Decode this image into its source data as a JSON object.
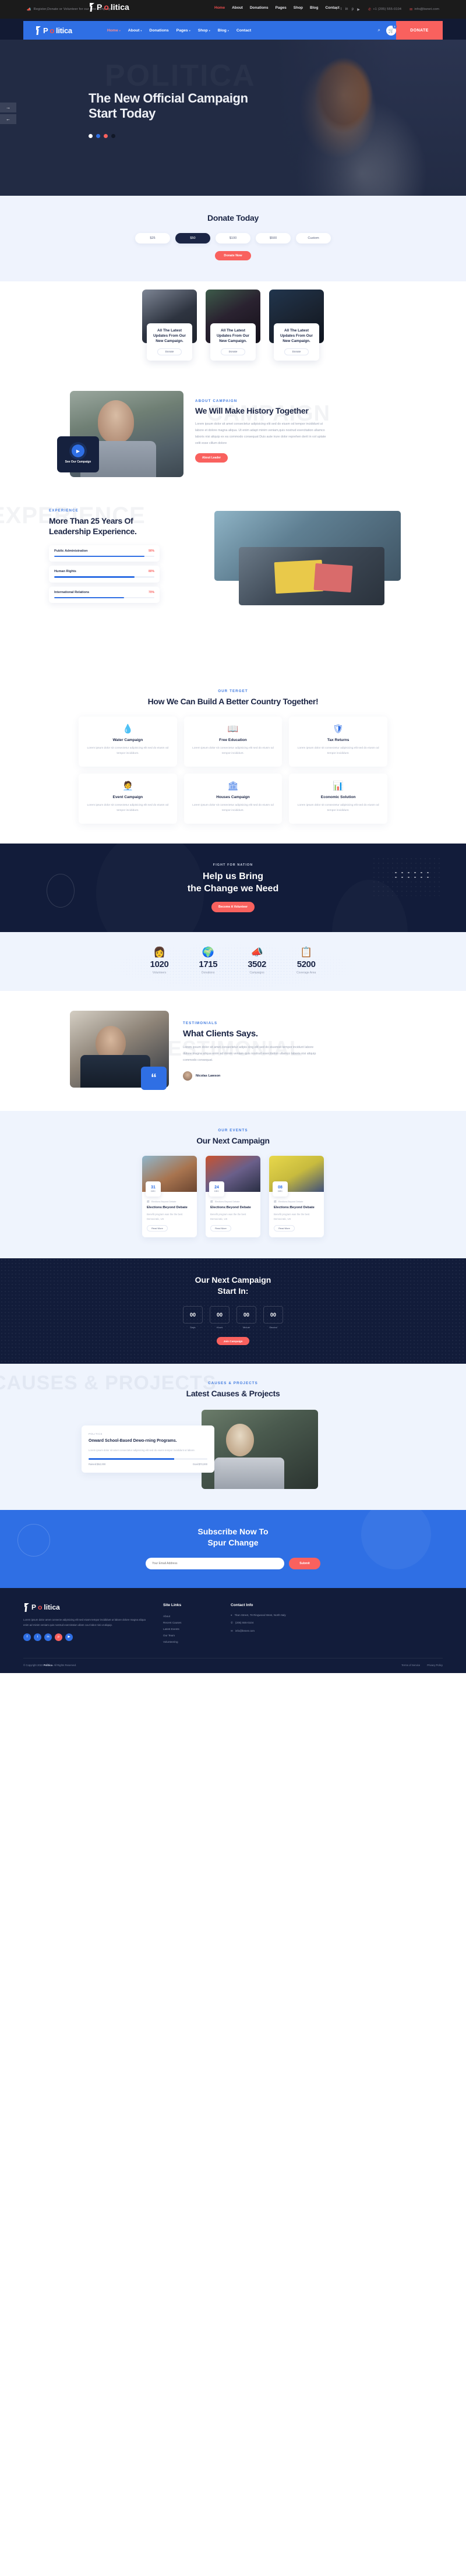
{
  "brand": {
    "name_pre": "P",
    "name_o": "o",
    "name_post": "litica",
    "full": "Politica"
  },
  "topbar": {
    "announce": "Register,Donate or Volunteer for our new campaign",
    "phone": "+1 (205) 555-0104",
    "email": "info@bsnet.com",
    "socials": [
      "f",
      "t",
      "in",
      "p",
      "yt"
    ]
  },
  "nav": {
    "items": [
      {
        "label": "Home",
        "caret": true,
        "active": true
      },
      {
        "label": "About",
        "caret": true,
        "active": false
      },
      {
        "label": "Donations",
        "caret": false,
        "active": false
      },
      {
        "label": "Pages",
        "caret": true,
        "active": false
      },
      {
        "label": "Shop",
        "caret": true,
        "active": false
      },
      {
        "label": "Blog",
        "caret": true,
        "active": false
      },
      {
        "label": "Contact",
        "caret": false,
        "active": false
      }
    ],
    "search_icon": "search-icon",
    "cart_icon": "cart-icon",
    "cart_count": "3",
    "donate_label": "DONATE"
  },
  "hero": {
    "ghost_word": "POLITICA",
    "title": "The New Official Campaign Start Today",
    "next_arrow": "→",
    "prev_arrow": "←",
    "dots": [
      "white",
      "blue",
      "red",
      "dark"
    ]
  },
  "donate": {
    "title": "Donate Today",
    "amounts": [
      {
        "label": "$25",
        "selected": false
      },
      {
        "label": "$50",
        "selected": true
      },
      {
        "label": "$100",
        "selected": false
      },
      {
        "label": "$500",
        "selected": false
      },
      {
        "label": "Custom",
        "selected": false
      }
    ],
    "cta": "Donate Now"
  },
  "donate_cards": [
    {
      "title": "All The Latest Updates From Our New Campaign.",
      "button": "Donate"
    },
    {
      "title": "All The Latest Updates From Our New Campaign.",
      "button": "Donate"
    },
    {
      "title": "All The Latest Updates From Our New Campaign.",
      "button": "Donate"
    }
  ],
  "about": {
    "ghost_word": "CAMPAIGN",
    "eyebrow": "ABOUT CAMPAIGN",
    "title": "We Will Make History Together",
    "paragraph": "Lorem ipsum dolor sit amet consectetur adipisicing elit sed do eiusm od tempor incididunt ut labore et dolore magna aliqua. Ut enim adapt minim veniam,quis nostrud exercitation ullamco laboris nisi aliquip ex ea commodo consequat Duis aute irure dolor reprehen derit in vol uptate velit esse cillum dolore",
    "button": "About Leader",
    "video_label": "See Our Campaign",
    "play_icon": "play-icon"
  },
  "experience": {
    "ghost_word": "EXPERIENCE",
    "eyebrow": "EXPERIENCE",
    "title": "More Than 25 Years Of Leadership Experience.",
    "skills": [
      {
        "name": "Public Administration",
        "percent": "90%",
        "value": 90
      },
      {
        "name": "Human Rights",
        "percent": "80%",
        "value": 80
      },
      {
        "name": "International Relations",
        "percent": "70%",
        "value": 70
      }
    ]
  },
  "target": {
    "eyebrow": "OUR TERGET",
    "title": "How We Can Build A Better Country Together!",
    "cards": [
      {
        "icon": "water-drop-hand-icon",
        "glyph": "💧",
        "title": "Water Campaign",
        "text": "Lorem ipsum dolor sit consectetur adipisicing elit sed do eiusm od tempor incididunt."
      },
      {
        "icon": "open-book-pen-icon",
        "glyph": "📖",
        "title": "Free Education",
        "text": "Lorem ipsum dolor sit consectetur adipisicing elit sed do eiusm od tempor incididunt."
      },
      {
        "icon": "shield-person-icon",
        "glyph": "🛡",
        "title": "Tax Returns",
        "text": "Lorem ipsum dolor sit consectetur adipisicing elit sed do eiusm od tempor incididunt."
      },
      {
        "icon": "speaker-person-icon",
        "glyph": "🧑‍💼",
        "title": "Event Campaign",
        "text": "Lorem ipsum dolor sit consectetur adipisicing elit sed do eiusm od tempor incididunt."
      },
      {
        "icon": "government-building-icon",
        "glyph": "🏛",
        "title": "Houses Campaign",
        "text": "Lorem ipsum dolor sit consectetur adipisicing elit sed do eiusm od tempor incididunt."
      },
      {
        "icon": "growth-chart-icon",
        "glyph": "📊",
        "title": "Economic Solution",
        "text": "Lorem ipsum dolor sit consectetur adipisicing elit sed do eiusm od tempor incididunt."
      }
    ]
  },
  "cta": {
    "eyebrow": "FIGHT FOR NATION",
    "title_line1": "Help us Bring",
    "title_line2": "the Change we Need",
    "button": "Become A Volunteer"
  },
  "counters": [
    {
      "icon": "volunteer-icon",
      "glyph": "👩",
      "number": "1020",
      "label": "Volunteers"
    },
    {
      "icon": "globe-hands-icon",
      "glyph": "🌍",
      "number": "1715",
      "label": "Donations"
    },
    {
      "icon": "megaphone-icon",
      "glyph": "📣",
      "number": "3502",
      "label": "Campaigns"
    },
    {
      "icon": "checklist-shield-icon",
      "glyph": "📋",
      "number": "5200",
      "label": "Coverage Area"
    }
  ],
  "testimonial": {
    "ghost_word": "TESTIMONIAL",
    "eyebrow": "TESTIMONIALS",
    "title": "What Clients Says.",
    "quote": "Lorem ipsum dolor sit amet,consectetur adipis cing elit sed do eiusmod tempor incidunt labore dolore magna aliqua enim ad minim veniam quis nostrud exercitation ullamco laboris nisi aliquip commodo consequat.",
    "author": "Nicolas Lawson",
    "quote_mark": "“"
  },
  "events": {
    "eyebrow": "OUR EVENTS",
    "title": "Our Next Campaign",
    "items": [
      {
        "day": "31",
        "month": "DEC",
        "meta": "Elections Beyond Debate",
        "title": "Elections:Beyond Debate",
        "text": "Benefit program was the the best Democratic, US",
        "button": "Read More"
      },
      {
        "day": "24",
        "month": "DEC",
        "meta": "Elections Beyond Debate",
        "title": "Elections:Beyond Debate",
        "text": "Benefit program was the the best Democratic, US",
        "button": "Read More"
      },
      {
        "day": "08",
        "month": "DEC",
        "meta": "Elections Beyond Debate",
        "title": "Elections:Beyond Debate",
        "text": "Benefit program was the the best Democratic, US",
        "button": "Read More"
      }
    ]
  },
  "countdown": {
    "title_line1": "Our Next Campaign",
    "title_line2": "Start In:",
    "units": [
      {
        "value": "00",
        "label": "Days"
      },
      {
        "value": "00",
        "label": "Hours"
      },
      {
        "value": "00",
        "label": "Minute"
      },
      {
        "value": "00",
        "label": "Second"
      }
    ],
    "button": "Join Campaign"
  },
  "causes": {
    "ghost_word": "CAUSES & PROJECTS",
    "eyebrow": "CAUSES & PROJECTS",
    "title": "Latest Causes & Projects",
    "card": {
      "tag": "POLITICS",
      "title": "Onward School-Based Dewo-rning Programs.",
      "text": "Lorem ipsum dolor sit amet consectetur adipisicing elit sed do eiusm tempor incididunt ut labore.",
      "raised_label": "Raised:$52,000",
      "goal_label": "Goal:$70,000",
      "progress": 72
    }
  },
  "subscribe": {
    "title_line1": "Subscribe Now To",
    "title_line2": "Spur Change",
    "placeholder": "Your Email Address",
    "button": "Submit"
  },
  "footer": {
    "about": "Lorem ipsum dolor amet consecte adipisicing elit sed eiusm tempor incididunt ut labore dolore magna aliqua enim ad minim veniam quis nostrud exercitation ullam cour labor nisi ut aliquip.",
    "socials": [
      "f",
      "t",
      "in",
      "p",
      "yt"
    ],
    "links_title": "Site Links",
    "links": [
      "About",
      "Recent Causes",
      "Latest Events",
      "Our Team",
      "Volunteering"
    ],
    "contact_title": "Contact Info",
    "contact": [
      {
        "icon": "location-icon",
        "glyph": "⌖",
        "text": "Titan Street, 78 Ringwood West, North Italy"
      },
      {
        "icon": "phone-icon",
        "glyph": "✆",
        "text": "(205) 555-0104"
      },
      {
        "icon": "mail-icon",
        "glyph": "✉",
        "text": "info@bsnet.com"
      }
    ],
    "copyright_pre": "© Copyright 2022 ",
    "copyright_brand": "Politica",
    "copyright_post": ". All Rights Reserved.",
    "bottom_links": [
      "Terms of Service",
      "Privacy Policy"
    ]
  }
}
